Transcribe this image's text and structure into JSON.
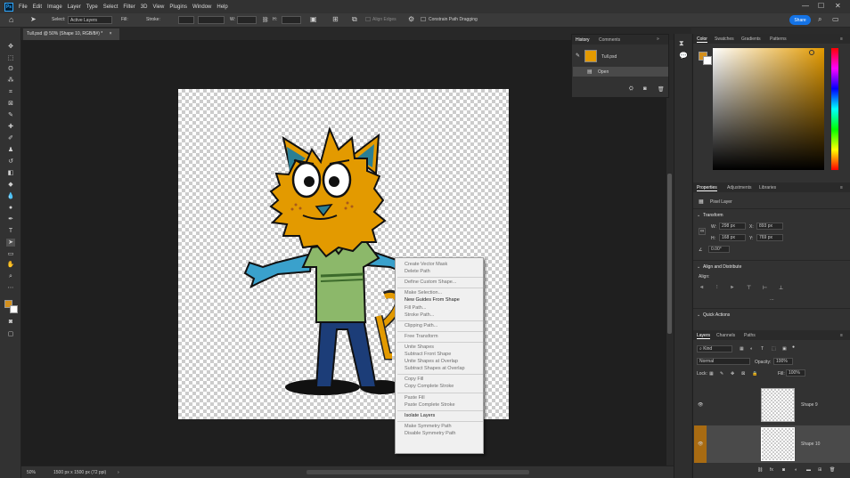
{
  "menubar": {
    "logo": "Ps",
    "items": [
      "File",
      "Edit",
      "Image",
      "Layer",
      "Type",
      "Select",
      "Filter",
      "3D",
      "View",
      "Plugins",
      "Window",
      "Help"
    ]
  },
  "options": {
    "select_label": "Select:",
    "select_value": "Active Layers",
    "fill_label": "Fill:",
    "stroke_label": "Stroke:",
    "w_label": "W:",
    "h_label": "H:",
    "align_edges": "Align Edges",
    "constrain": "Constrain Path Dragging",
    "share": "Share",
    "fill_color": "#7aad5a",
    "stroke_color": "#111111"
  },
  "document": {
    "tab_title": "Tull.psd @ 50% (Shape 10, RGB/8#) *",
    "tab_close": "×"
  },
  "status": {
    "zoom": "50%",
    "doc_size": "1500 px x 1500 px (72 ppi)"
  },
  "history": {
    "tabs": [
      "History",
      "Comments"
    ],
    "rows": [
      "Tull.psd",
      "Open"
    ]
  },
  "color_panel": {
    "tabs": [
      "Color",
      "Swatches",
      "Gradients",
      "Patterns"
    ],
    "foreground": "#d4901c",
    "background": "#ffffff",
    "hue": "#e39a00"
  },
  "properties": {
    "tabs": [
      "Properties",
      "Adjustments",
      "Libraries"
    ],
    "layer_type": "Pixel Layer",
    "transform_label": "Transform",
    "w": "298 px",
    "x": "893 px",
    "h": "168 px",
    "y": "769 px",
    "angle": "0.00°",
    "align_label": "Align and Distribute",
    "align_sub": "Align:",
    "quick_actions": "Quick Actions"
  },
  "layers": {
    "tabs": [
      "Layers",
      "Channels",
      "Paths"
    ],
    "kind": "Kind",
    "blend": "Normal",
    "opacity_label": "Opacity:",
    "opacity": "100%",
    "lock_label": "Lock:",
    "fill_label": "Fill:",
    "fill": "100%",
    "rows": [
      {
        "name": "Shape 9"
      },
      {
        "name": "Shape 10"
      }
    ]
  },
  "context_menu": {
    "items": [
      {
        "label": "Create Vector Mask",
        "enabled": false
      },
      {
        "label": "Delete Path",
        "enabled": false
      },
      {
        "sep": true
      },
      {
        "label": "Define Custom Shape...",
        "enabled": false
      },
      {
        "sep": true
      },
      {
        "label": "Make Selection...",
        "enabled": false
      },
      {
        "label": "New Guides From Shape",
        "enabled": true
      },
      {
        "label": "Fill Path...",
        "enabled": false
      },
      {
        "label": "Stroke Path...",
        "enabled": false
      },
      {
        "sep": true
      },
      {
        "label": "Clipping Path...",
        "enabled": false
      },
      {
        "sep": true
      },
      {
        "label": "Free Transform",
        "enabled": false
      },
      {
        "sep": true
      },
      {
        "label": "Unite Shapes",
        "enabled": false
      },
      {
        "label": "Subtract Front Shape",
        "enabled": false
      },
      {
        "label": "Unite Shapes at Overlap",
        "enabled": false
      },
      {
        "label": "Subtract Shapes at Overlap",
        "enabled": false
      },
      {
        "sep": true
      },
      {
        "label": "Copy Fill",
        "enabled": false
      },
      {
        "label": "Copy Complete Stroke",
        "enabled": false
      },
      {
        "sep": true
      },
      {
        "label": "Paste Fill",
        "enabled": false
      },
      {
        "label": "Paste Complete Stroke",
        "enabled": false
      },
      {
        "sep": true
      },
      {
        "label": "Isolate Layers",
        "enabled": true
      },
      {
        "sep": true
      },
      {
        "label": "Make Symmetry Path",
        "enabled": false
      },
      {
        "label": "Disable Symmetry Path",
        "enabled": false
      }
    ]
  }
}
